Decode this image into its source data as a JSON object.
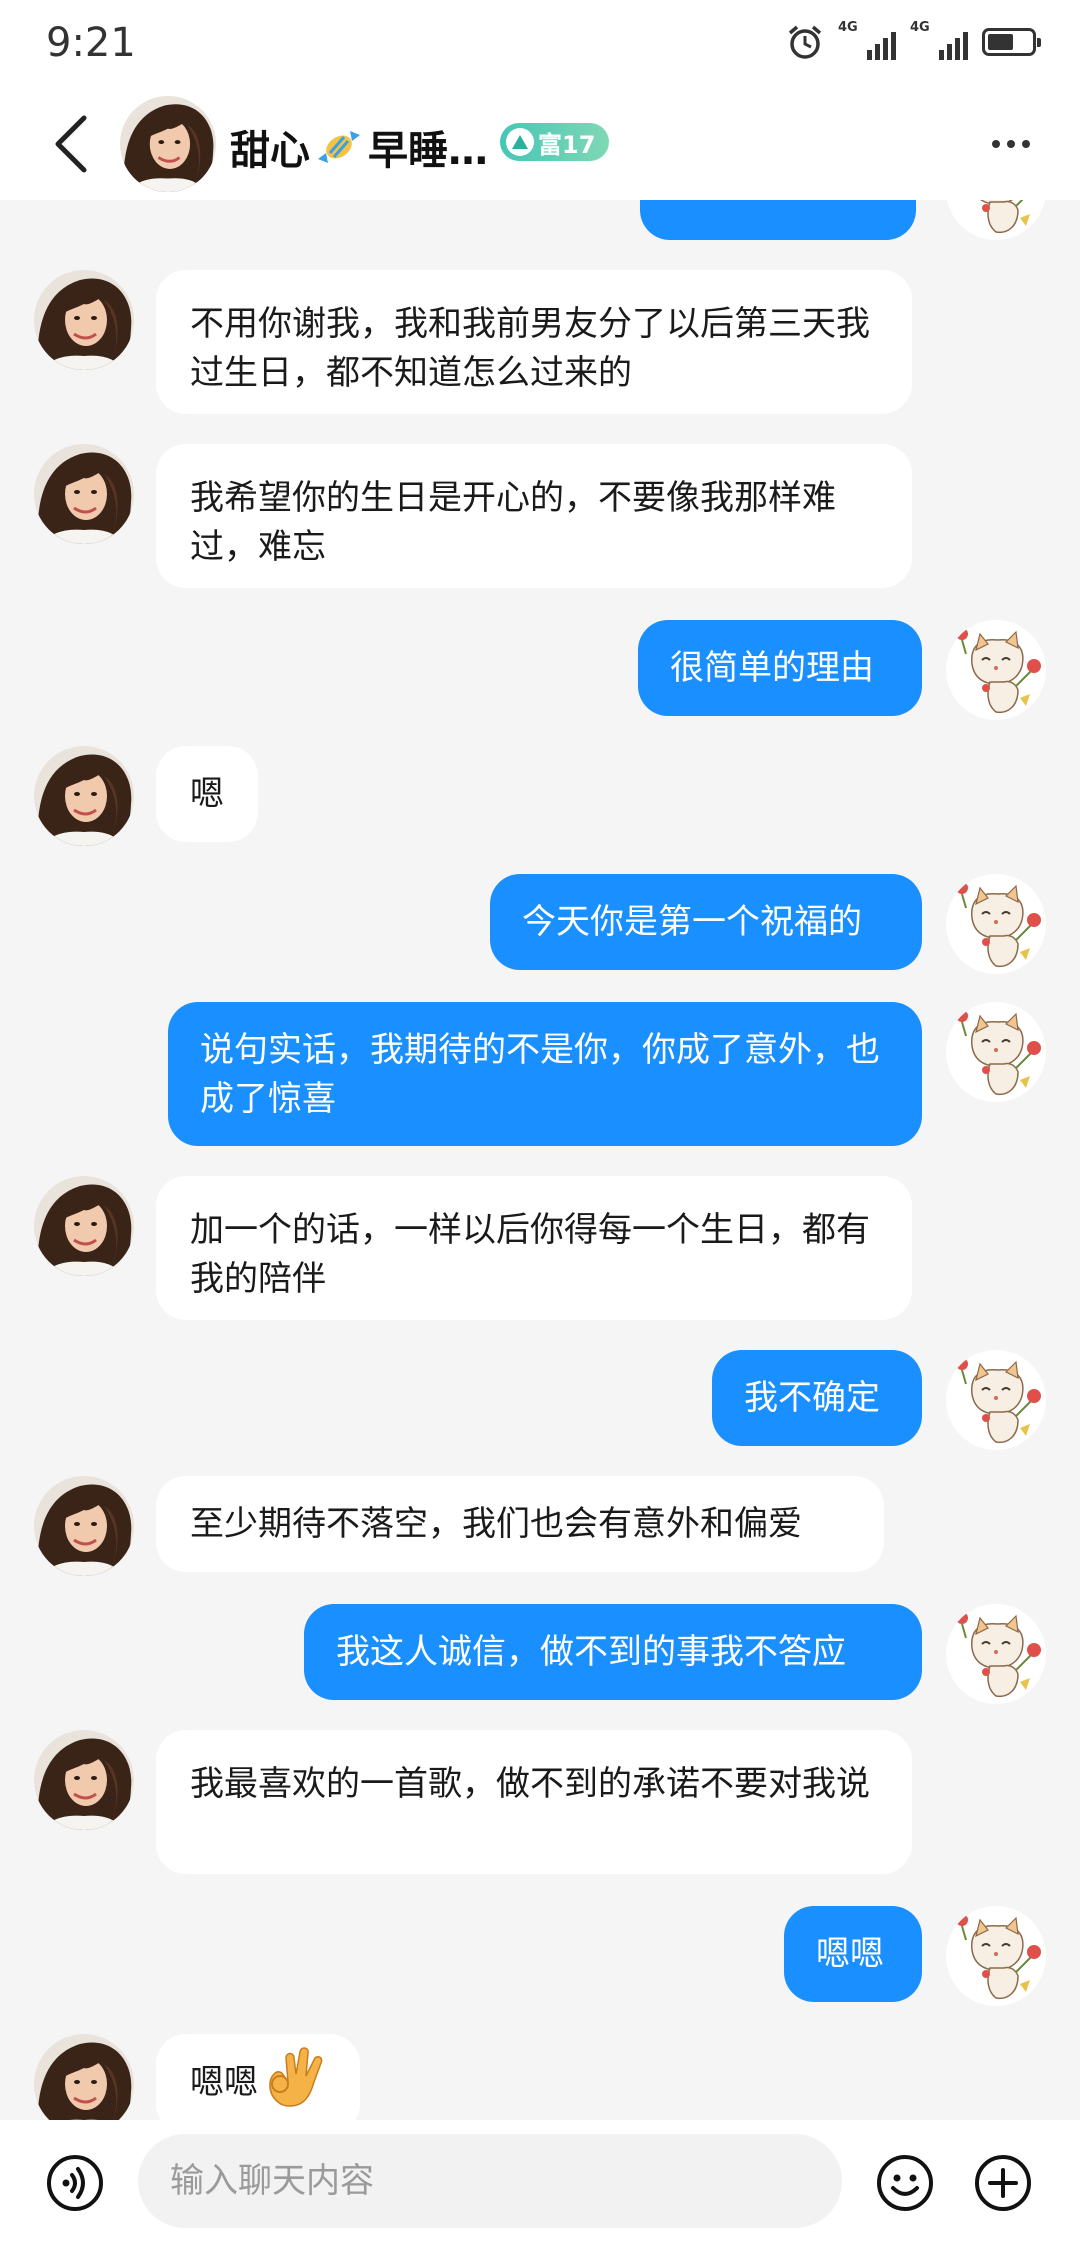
{
  "status_bar": {
    "time": "9:21",
    "sim1": "4G",
    "sim2": "4G",
    "battery_level": 0.6
  },
  "header": {
    "contact_name": "甜心",
    "name_suffix": "早睡…",
    "badge_label": "富17",
    "icons": {
      "back": "chevron-left-icon",
      "name_emoji": "candy-icon",
      "badge": "wealth-level-icon",
      "more": "more-icon"
    }
  },
  "messages": [
    {
      "side": "in",
      "text": "不用你谢我，我和我前男友分了以后第三天我过生日，都不知道怎么过来的"
    },
    {
      "side": "in",
      "text": "我希望你的生日是开心的，不要像我那样难过，难忘"
    },
    {
      "side": "out",
      "text": "很简单的理由"
    },
    {
      "side": "in",
      "text": "嗯"
    },
    {
      "side": "out",
      "text": "今天你是第一个祝福的"
    },
    {
      "side": "out",
      "text": "说句实话，我期待的不是你，你成了意外，也成了惊喜"
    },
    {
      "side": "in",
      "text": "加一个的话，一样以后你得每一个生日，都有我的陪伴"
    },
    {
      "side": "out",
      "text": "我不确定"
    },
    {
      "side": "in",
      "text": "至少期待不落空，我们也会有意外和偏爱"
    },
    {
      "side": "out",
      "text": "我这人诚信，做不到的事我不答应"
    },
    {
      "side": "in",
      "text": "我最喜欢的一首歌，做不到的承诺不要对我说"
    },
    {
      "side": "out",
      "text": "嗯嗯"
    },
    {
      "side": "in",
      "text": "嗯嗯",
      "emoji": "ok-hand-icon"
    }
  ],
  "input_bar": {
    "placeholder": "输入聊天内容",
    "icons": {
      "voice": "voice-icon",
      "emoji": "emoji-icon",
      "add": "plus-icon"
    }
  },
  "colors": {
    "outgoing_bubble": "#1a8fff",
    "incoming_bubble": "#ffffff",
    "chat_background": "#f5f5f5",
    "badge": "#46c6b6"
  }
}
